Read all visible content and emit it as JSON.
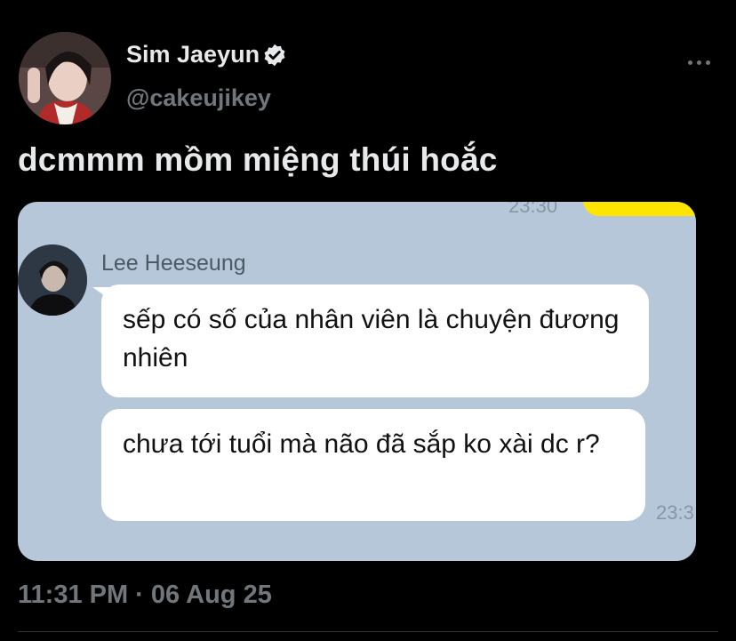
{
  "author": {
    "name": "Sim Jaeyun",
    "handle": "@cakeujikey",
    "verified_icon": "verified-badge-icon"
  },
  "tweet": {
    "text": "dcmmm mồm miệng thúi hoắc",
    "timestamp": "11:31 PM · 06 Aug 25"
  },
  "media": {
    "top_time": "23:30",
    "sender_name": "Lee Heeseung",
    "messages": [
      "sếp có số của nhân viên là chuyện đương nhiên",
      "chưa tới tuổi mà não đã sắp ko xài dc r?"
    ],
    "bottom_time": "23:3"
  },
  "colors": {
    "background": "#000000",
    "chat_background": "#b5c7d8",
    "kakao_yellow": "#fee500",
    "verified_fill": "#e7e9ea"
  }
}
